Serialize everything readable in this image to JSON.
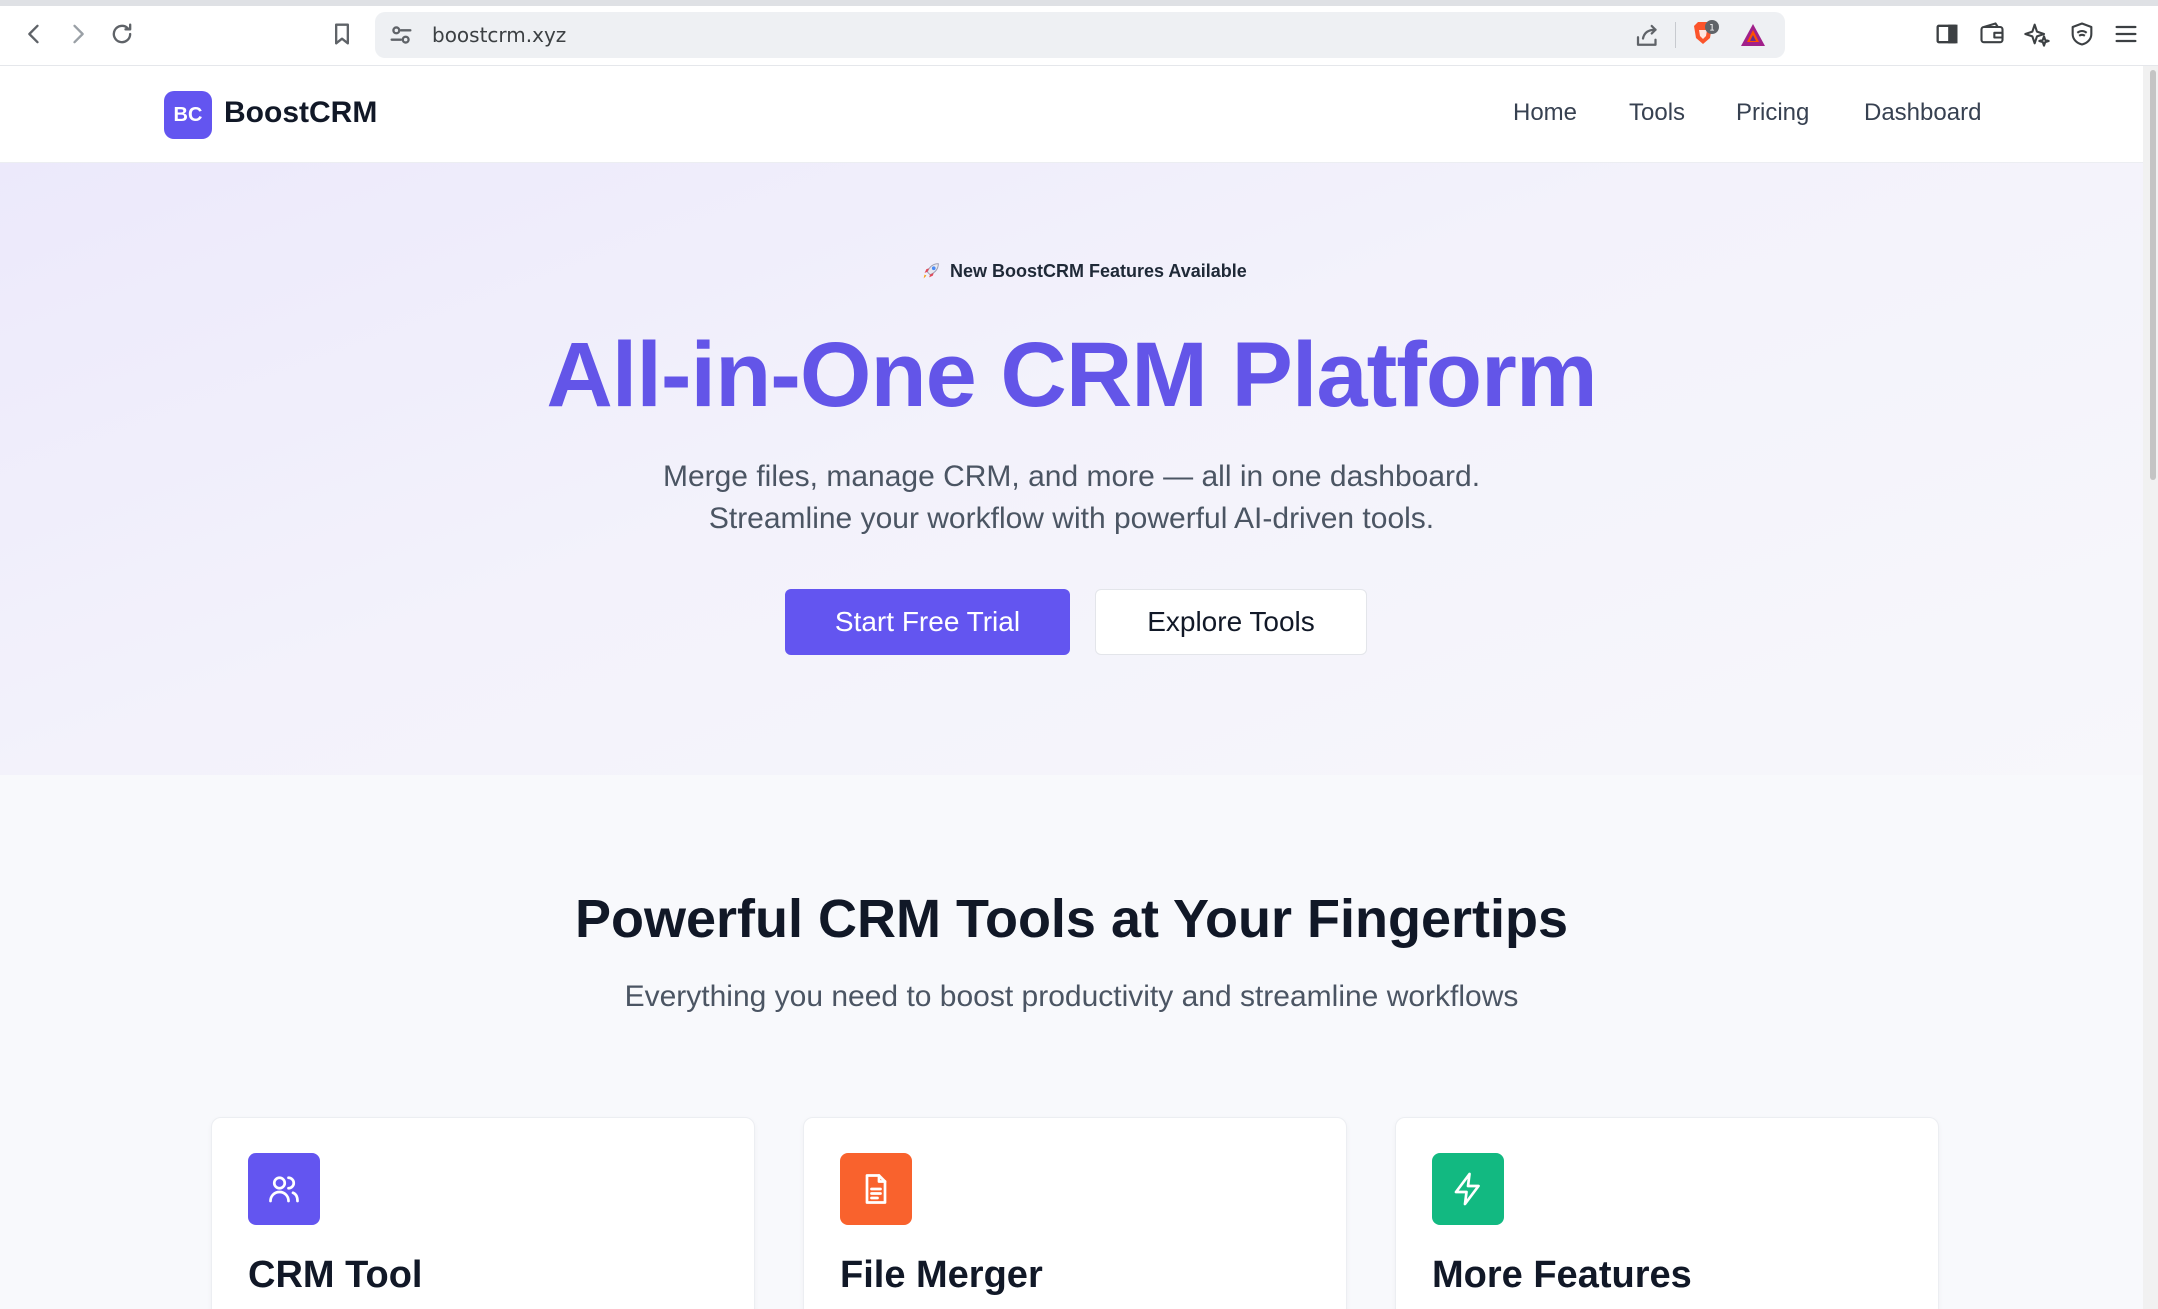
{
  "browser": {
    "url": "boostcrm.xyz",
    "icons": [
      "back-icon",
      "forward-icon",
      "reload-icon",
      "bookmark-icon",
      "site-settings-icon",
      "share-icon",
      "brave-shields-icon",
      "brave-rewards-icon",
      "sidebar-icon",
      "wallet-icon",
      "leo-ai-icon",
      "vpn-icon",
      "menu-icon"
    ],
    "shields_count": "1"
  },
  "header": {
    "logo_initials": "BC",
    "logo_text": "BoostCRM",
    "nav": [
      {
        "label": "Home"
      },
      {
        "label": "Tools"
      },
      {
        "label": "Pricing"
      },
      {
        "label": "Dashboard"
      }
    ]
  },
  "hero": {
    "badge_text": "New BoostCRM Features Available",
    "badge_icon": "rocket-icon",
    "title": "All-in-One CRM Platform",
    "subtitle_line1": "Merge files, manage CRM, and more — all in one dashboard.",
    "subtitle_line2": "Streamline your workflow with powerful AI-driven tools.",
    "primary_cta": "Start Free Trial",
    "secondary_cta": "Explore Tools"
  },
  "tools": {
    "title": "Powerful CRM Tools at Your Fingertips",
    "subtitle": "Everything you need to boost productivity and streamline workflows",
    "cards": [
      {
        "title": "CRM Tool",
        "icon": "users-icon",
        "color": "#6355f0"
      },
      {
        "title": "File Merger",
        "icon": "file-icon",
        "color": "#f9622d"
      },
      {
        "title": "More Features",
        "icon": "lightning-icon",
        "color": "#12b981"
      }
    ]
  },
  "colors": {
    "accent": "#6355f0",
    "hero_title": "#6355e8",
    "orange": "#f9622d",
    "green": "#12b981"
  }
}
